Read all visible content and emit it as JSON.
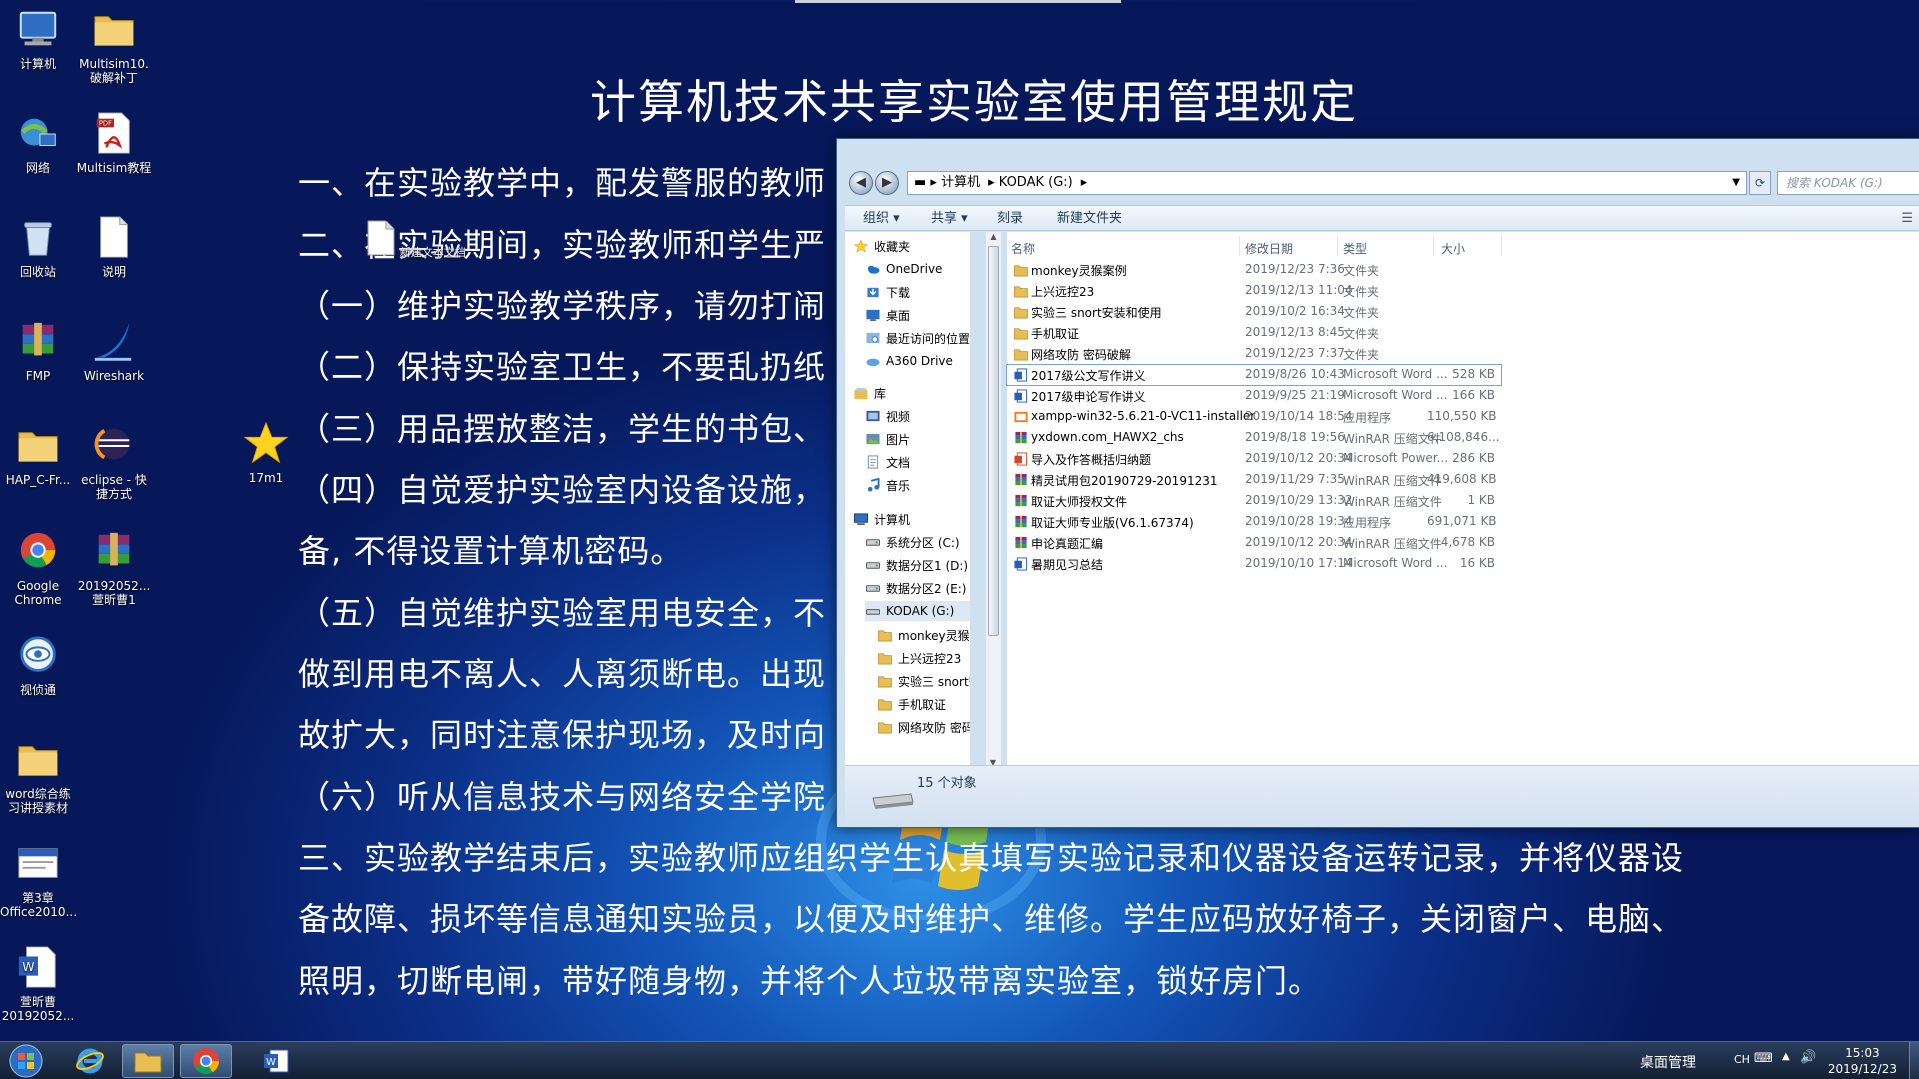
{
  "document": {
    "title": "计算机技术共享实验室使用管理规定",
    "lines": [
      "一、在实验教学中，配发警服的教师",
      "二、在实验期间，实验教师和学生严",
      "（一）维护实验教学秩序，请勿打闹",
      "（二）保持实验室卫生，不要乱扔纸",
      "（三）用品摆放整洁，学生的书包、",
      "（四）自觉爱护实验室内设备设施，",
      "备, 不得设置计算机密码。",
      "（五）自觉维护实验室用电安全，不",
      "做到用电不离人、人离须断电。出现",
      "故扩大，同时注意保护现场，及时向",
      "（六）听从信息技术与网络安全学院",
      "三、实验教学结束后，实验教师应组织学生认真填写实验记录和仪器设备运转记录，并将仪器设",
      "备故障、损坏等信息通知实验员，以便及时维护、维修。学生应码放好椅子，关闭窗户、电脑、",
      "照明，切断电闸，带好随身物，并将个人垃圾带离实验室，锁好房门。"
    ]
  },
  "desktop_icons": [
    {
      "label": "计算机",
      "icon": "computer-icon"
    },
    {
      "label": "Multisim10. 破解补丁",
      "icon": "folder-icon"
    },
    {
      "label": "网络",
      "icon": "network-icon"
    },
    {
      "label": "Multisim教程",
      "icon": "pdf-icon"
    },
    {
      "label": "回收站",
      "icon": "recycle-bin-icon"
    },
    {
      "label": "说明",
      "icon": "text-file-icon"
    },
    {
      "label": "FMP",
      "icon": "winrar-icon"
    },
    {
      "label": "Wireshark",
      "icon": "wireshark-icon"
    },
    {
      "label": "HAP_C-Fr...",
      "icon": "folder-icon"
    },
    {
      "label": "eclipse - 快捷方式",
      "icon": "eclipse-icon"
    },
    {
      "label": "Google Chrome",
      "icon": "chrome-icon"
    },
    {
      "label": "20192052... 萱昕曹1",
      "icon": "winrar-icon"
    },
    {
      "label": "视侦通",
      "icon": "eye-app-icon"
    },
    {
      "label": "word综合练习讲授素材",
      "icon": "folder-icon"
    },
    {
      "label": "第3章 Office2010...",
      "icon": "document-icon"
    },
    {
      "label": "萱昕曹 20192052...",
      "icon": "word-doc-icon"
    },
    {
      "label": "17m1",
      "icon": "star-icon"
    }
  ],
  "ghost_file_label": "新建文本文档",
  "explorer": {
    "breadcrumb": [
      "计算机",
      "KODAK (G:)"
    ],
    "search_placeholder": "搜索 KODAK (G:)",
    "toolbar": {
      "organize": "组织 ▾",
      "share": "共享 ▾",
      "burn": "刻录",
      "new_folder": "新建文件夹"
    },
    "nav": [
      {
        "label": "收藏夹",
        "icon": "star-icon",
        "level": 0
      },
      {
        "label": "OneDrive",
        "icon": "onedrive-icon",
        "level": 1
      },
      {
        "label": "下载",
        "icon": "download-icon",
        "level": 1
      },
      {
        "label": "桌面",
        "icon": "desktop-icon",
        "level": 1
      },
      {
        "label": "最近访问的位置",
        "icon": "recent-icon",
        "level": 1
      },
      {
        "label": "A360 Drive",
        "icon": "cloud-icon",
        "level": 1
      },
      {
        "label": "库",
        "icon": "library-icon",
        "level": 0
      },
      {
        "label": "视频",
        "icon": "video-icon",
        "level": 1
      },
      {
        "label": "图片",
        "icon": "picture-icon",
        "level": 1
      },
      {
        "label": "文档",
        "icon": "documents-icon",
        "level": 1
      },
      {
        "label": "音乐",
        "icon": "music-icon",
        "level": 1
      },
      {
        "label": "计算机",
        "icon": "computer-icon",
        "level": 0
      },
      {
        "label": "系统分区 (C:)",
        "icon": "drive-icon",
        "level": 1
      },
      {
        "label": "数据分区1 (D:)",
        "icon": "drive-icon",
        "level": 1
      },
      {
        "label": "数据分区2 (E:)",
        "icon": "drive-icon",
        "level": 1
      },
      {
        "label": "KODAK (G:)",
        "icon": "usb-drive-icon",
        "level": 1
      },
      {
        "label": "monkey灵猴案",
        "icon": "folder-icon",
        "level": 2
      },
      {
        "label": "上兴远控23",
        "icon": "folder-icon",
        "level": 2
      },
      {
        "label": "实验三 snort安",
        "icon": "folder-icon",
        "level": 2
      },
      {
        "label": "手机取证",
        "icon": "folder-icon",
        "level": 2
      },
      {
        "label": "网络攻防 密码",
        "icon": "folder-icon",
        "level": 2
      }
    ],
    "columns": {
      "name": "名称",
      "date": "修改日期",
      "type": "类型",
      "size": "大小"
    },
    "files": [
      {
        "name": "monkey灵猴案例",
        "date": "2019/12/23 7:36",
        "type": "文件夹",
        "size": "",
        "icon": "folder-icon"
      },
      {
        "name": "上兴远控23",
        "date": "2019/12/13 11:04",
        "type": "文件夹",
        "size": "",
        "icon": "folder-icon"
      },
      {
        "name": "实验三 snort安装和使用",
        "date": "2019/10/2 16:34",
        "type": "文件夹",
        "size": "",
        "icon": "folder-icon"
      },
      {
        "name": "手机取证",
        "date": "2019/12/13 8:45",
        "type": "文件夹",
        "size": "",
        "icon": "folder-icon"
      },
      {
        "name": "网络攻防 密码破解",
        "date": "2019/12/23 7:37",
        "type": "文件夹",
        "size": "",
        "icon": "folder-icon"
      },
      {
        "name": "2017级公文写作讲义",
        "date": "2019/8/26 10:43",
        "type": "Microsoft Word ...",
        "size": "528 KB",
        "icon": "word-icon",
        "selected": true
      },
      {
        "name": "2017级申论写作讲义",
        "date": "2019/9/25 21:19",
        "type": "Microsoft Word ...",
        "size": "166 KB",
        "icon": "word-icon"
      },
      {
        "name": "xampp-win32-5.6.21-0-VC11-installer",
        "date": "2019/10/14 18:54",
        "type": "应用程序",
        "size": "110,550 KB",
        "icon": "app-icon"
      },
      {
        "name": "yxdown.com_HAWX2_chs",
        "date": "2019/8/18 19:56",
        "type": "WinRAR 压缩文件",
        "size": "6,108,846...",
        "icon": "rar-icon"
      },
      {
        "name": "导入及作答概括归纳题",
        "date": "2019/10/12 20:34",
        "type": "Microsoft Power...",
        "size": "286 KB",
        "icon": "ppt-icon"
      },
      {
        "name": "精灵试用包20190729-20191231",
        "date": "2019/11/29 7:35",
        "type": "WinRAR 压缩文件",
        "size": "419,608 KB",
        "icon": "rar-icon"
      },
      {
        "name": "取证大师授权文件",
        "date": "2019/10/29 13:32",
        "type": "WinRAR 压缩文件",
        "size": "1 KB",
        "icon": "rar-icon"
      },
      {
        "name": "取证大师专业版(V6.1.67374)",
        "date": "2019/10/28 19:34",
        "type": "应用程序",
        "size": "691,071 KB",
        "icon": "rar-icon"
      },
      {
        "name": "申论真题汇编",
        "date": "2019/10/12 20:34",
        "type": "WinRAR 压缩文件",
        "size": "4,678 KB",
        "icon": "rar-icon"
      },
      {
        "name": "暑期见习总结",
        "date": "2019/10/10 17:14",
        "type": "Microsoft Word ...",
        "size": "16 KB",
        "icon": "word-icon"
      }
    ],
    "status": "15 个对象"
  },
  "taskbar": {
    "apps": [
      {
        "name": "start-button",
        "icon": "windows-logo-icon"
      },
      {
        "name": "ie-button",
        "icon": "ie-icon"
      },
      {
        "name": "explorer-button",
        "icon": "folder-icon"
      },
      {
        "name": "chrome-button",
        "icon": "chrome-icon"
      },
      {
        "name": "word-button",
        "icon": "word-icon"
      }
    ],
    "desktop_toolbar": "桌面管理",
    "lang": "CH",
    "time": "15:03",
    "date": "2019/12/23"
  },
  "colors": {
    "folder": "#e8bd52",
    "word": "#2b5cb8",
    "rar": "#8b2a6d",
    "ppt": "#d24726",
    "wallpaper_dark": "#06185a",
    "wallpaper_light": "#2d8fe6"
  }
}
